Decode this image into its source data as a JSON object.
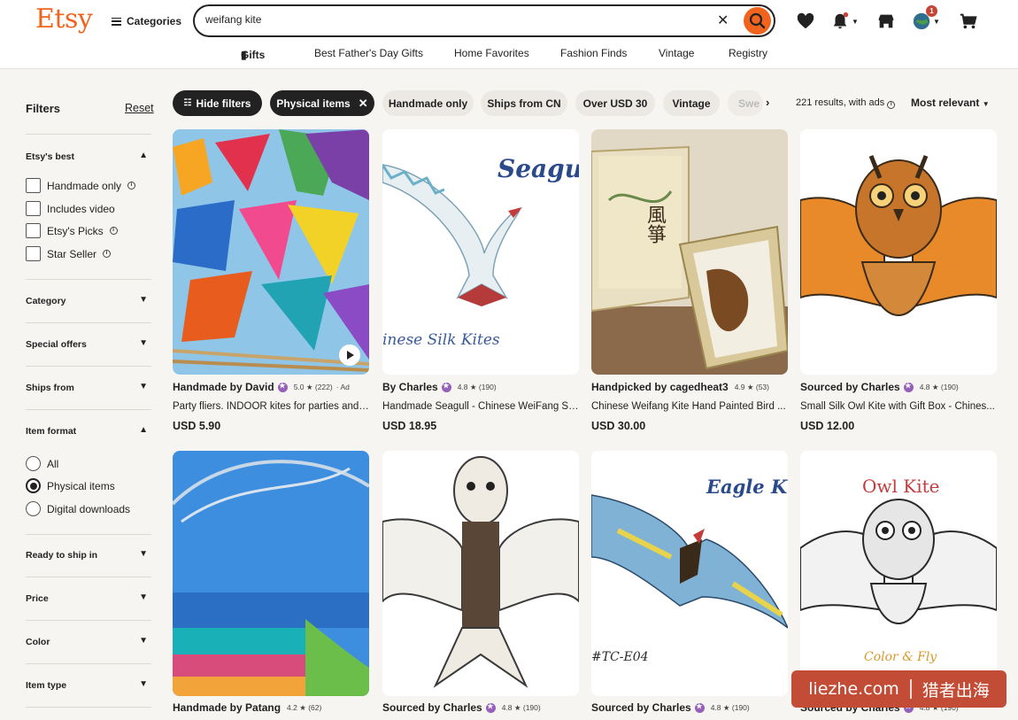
{
  "header": {
    "logo": "Etsy",
    "categories_label": "Categories",
    "search_value": "weifang kite",
    "notification_count": "1"
  },
  "subnav": [
    "Gifts",
    "Best Father's Day Gifts",
    "Home Favorites",
    "Fashion Finds",
    "Vintage",
    "Registry"
  ],
  "filters": {
    "title": "Filters",
    "reset": "Reset",
    "etsys_best": {
      "label": "Etsy's best",
      "options": [
        "Handmade only",
        "Includes video",
        "Etsy's Picks",
        "Star Seller"
      ]
    },
    "category": "Category",
    "special_offers": "Special offers",
    "ships_from": "Ships from",
    "item_format": {
      "label": "Item format",
      "options": [
        "All",
        "Physical items",
        "Digital downloads"
      ],
      "selected": "Physical items"
    },
    "ready_to_ship": "Ready to ship in",
    "price": "Price",
    "color": "Color",
    "item_type": "Item type"
  },
  "chips": {
    "hide_filters": "Hide filters",
    "physical_items": "Physical items",
    "handmade_only": "Handmade only",
    "ships_from_cn": "Ships from CN",
    "over_usd_30": "Over USD 30",
    "vintage": "Vintage",
    "truncated": "Swe"
  },
  "results_text": "221 results, with ads",
  "sort_label": "Most relevant",
  "products": [
    {
      "seller": "Handmade by David",
      "rating": "5.0 ★ (222)",
      "ad": "· Ad",
      "title": "Party fliers. INDOOR kites for parties and ...",
      "price": "USD 5.90"
    },
    {
      "seller": "By Charles",
      "rating": "4.8 ★ (190)",
      "ad": "",
      "title": "Handmade Seagull - Chinese WeiFang Sil...",
      "price": "USD 18.95"
    },
    {
      "seller": "Handpicked by cagedheat3",
      "rating": "4.9 ★ (53)",
      "ad": "",
      "title": "Chinese Weifang Kite Hand Painted Bird ...",
      "price": "USD 30.00"
    },
    {
      "seller": "Sourced by Charles",
      "rating": "4.8 ★ (190)",
      "ad": "",
      "title": "Small Silk Owl Kite with Gift Box - Chines...",
      "price": "USD 12.00"
    },
    {
      "seller": "Handmade by Patang",
      "rating": "4.2 ★ (62)",
      "ad": "",
      "title": "",
      "price": ""
    },
    {
      "seller": "Sourced by Charles",
      "rating": "4.8 ★ (190)",
      "ad": "",
      "title": "",
      "price": ""
    },
    {
      "seller": "Sourced by Charles",
      "rating": "4.8 ★ (190)",
      "ad": "",
      "title": "",
      "price": ""
    },
    {
      "seller": "Sourced by Charles",
      "rating": "4.8 ★ (190)",
      "ad": "",
      "title": "",
      "price": ""
    }
  ],
  "image_text": {
    "seagull_caption": "Seagul",
    "seagull_sub": "inese Silk Kites",
    "eagle_caption": "Eagle Kit",
    "eagle_code": "#TC-E04",
    "owl_caption": "Owl Kite",
    "owl_sub": "Color & Fly",
    "box_chars": "風箏"
  },
  "watermark": {
    "site": "liezhe.com",
    "name": "猎者出海"
  },
  "colors": {
    "brand": "#f1641e",
    "dark_chip": "#222222",
    "star_seller": "#9560b8",
    "watermark": "#c24c35"
  }
}
